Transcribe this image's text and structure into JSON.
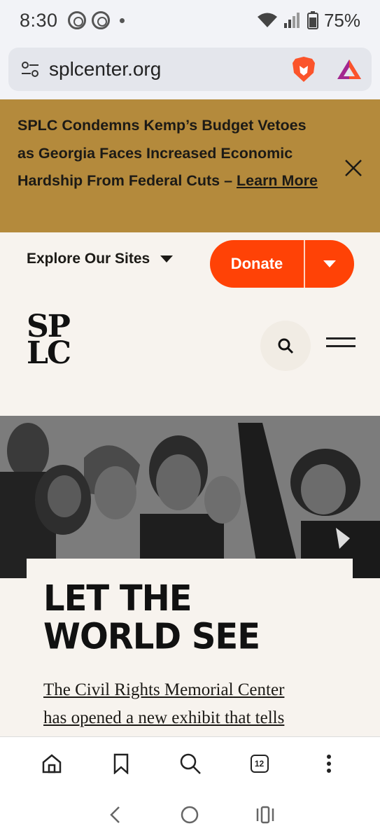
{
  "status_bar": {
    "time": "8:30",
    "battery": "75%"
  },
  "url_bar": {
    "url": "splcenter.org",
    "icons": [
      "site-settings-icon",
      "brave-shield-icon",
      "brave-rewards-icon"
    ]
  },
  "banner": {
    "text": "SPLC Condemns Kemp’s Budget Vetoes as Georgia Faces Increased Economic Hardship From Federal Cuts – ",
    "link": "Learn More",
    "bg_color": "#b48a3c"
  },
  "nav": {
    "explore_label": "Explore Our Sites",
    "donate_label": "Donate",
    "accent": "#ff4206"
  },
  "logo": {
    "line1": "SP",
    "line2": "LC"
  },
  "hero": {
    "title_line1": "LET THE",
    "title_line2": "WORLD SEE",
    "desc_line1": "The Civil Rights Memorial Center",
    "desc_line2": "has opened a new exhibit that tells"
  },
  "browser_toolbar": {
    "tabs_count": "12",
    "items": [
      "home-icon",
      "bookmark-icon",
      "search-icon",
      "tabs-icon",
      "more-icon"
    ]
  },
  "system_nav": {
    "items": [
      "back-icon",
      "home-circle-icon",
      "recents-icon"
    ]
  }
}
